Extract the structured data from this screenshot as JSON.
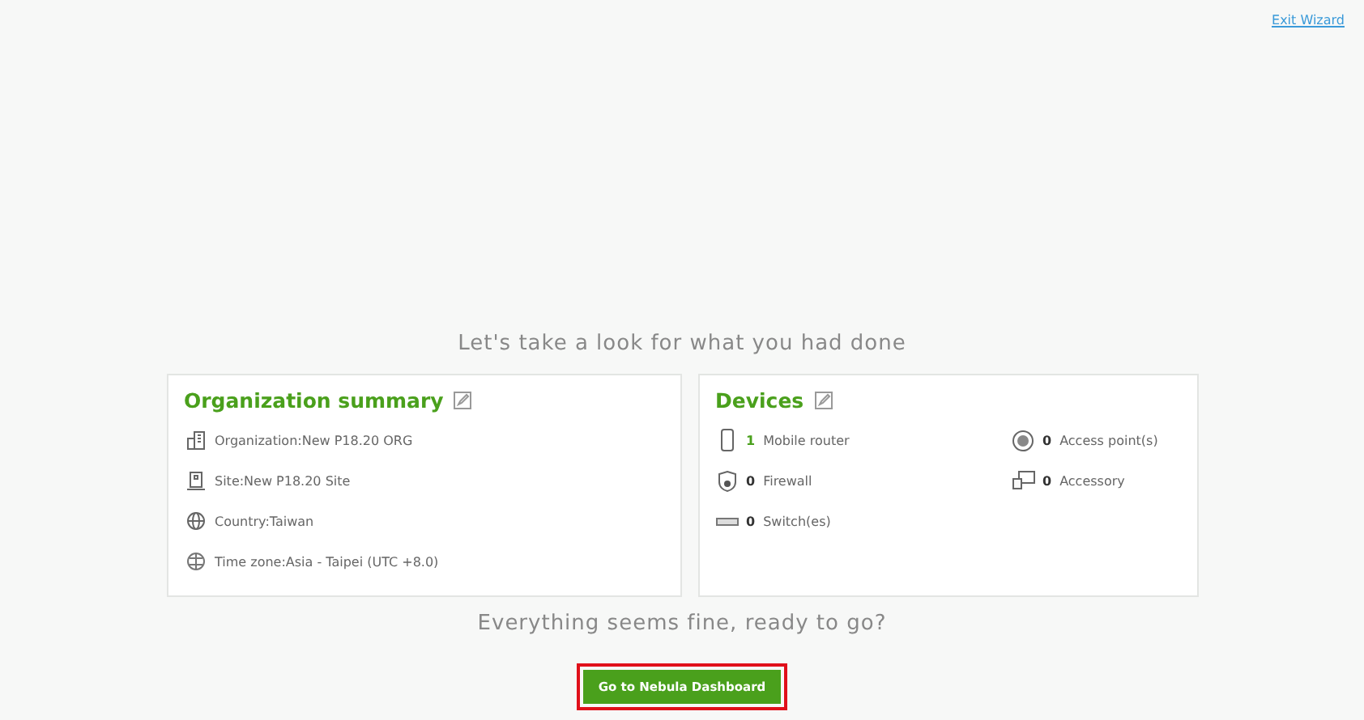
{
  "exit_link": "Exit Wizard",
  "heading": "Let's take a look for what you had done",
  "organization_summary": {
    "title": "Organization summary",
    "items": [
      {
        "kind": "building",
        "text": "Organization:New P18.20 ORG"
      },
      {
        "kind": "site",
        "text": "Site:New P18.20 Site"
      },
      {
        "kind": "globe",
        "text": "Country:Taiwan"
      },
      {
        "kind": "clock-globe",
        "text": "Time zone:Asia - Taipei (UTC +8.0)"
      }
    ]
  },
  "devices": {
    "title": "Devices",
    "items": [
      {
        "kind": "phone",
        "count": "1",
        "label": "Mobile router",
        "active": true
      },
      {
        "kind": "ap",
        "count": "0",
        "label": "Access point(s)",
        "active": false
      },
      {
        "kind": "shield",
        "count": "0",
        "label": "Firewall",
        "active": false
      },
      {
        "kind": "accessory",
        "count": "0",
        "label": "Accessory",
        "active": false
      },
      {
        "kind": "switch",
        "count": "0",
        "label": "Switch(es)",
        "active": false
      }
    ]
  },
  "footer_text": "Everything seems fine, ready to go?",
  "dashboard_button": "Go to Nebula Dashboard"
}
